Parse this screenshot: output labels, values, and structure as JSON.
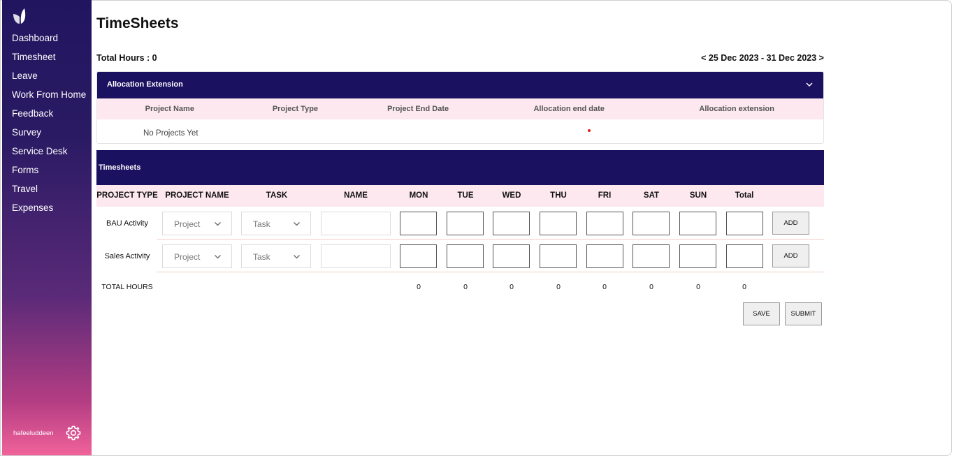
{
  "sidebar": {
    "items": [
      {
        "label": "Dashboard"
      },
      {
        "label": "Timesheet"
      },
      {
        "label": "Leave"
      },
      {
        "label": "Work From Home"
      },
      {
        "label": "Feedback"
      },
      {
        "label": "Survey"
      },
      {
        "label": "Service Desk"
      },
      {
        "label": "Forms"
      },
      {
        "label": "Travel"
      },
      {
        "label": "Expenses"
      }
    ],
    "username": "hafeeluddeen"
  },
  "page": {
    "title": "TimeSheets",
    "total_hours": "Total Hours : 0",
    "date_range": "< 25 Dec 2023 - 31 Dec 2023 >"
  },
  "allocation": {
    "title": "Allocation Extension",
    "columns": [
      "Project Name",
      "Project Type",
      "Project End Date",
      "Allocation end date",
      "Allocation extension"
    ],
    "empty_text": "No Projects Yet"
  },
  "timesheets": {
    "title": "Timesheets",
    "columns": [
      "PROJECT TYPE",
      "PROJECT NAME",
      "TASK",
      "NAME",
      "MON",
      "TUE",
      "WED",
      "THU",
      "FRI",
      "SAT",
      "SUN",
      "Total"
    ],
    "rows": [
      {
        "type": "BAU Activity",
        "project_placeholder": "Project",
        "task_placeholder": "Task",
        "add_label": "ADD"
      },
      {
        "type": "Sales Activity",
        "project_placeholder": "Project",
        "task_placeholder": "Task",
        "add_label": "ADD"
      }
    ],
    "totals": {
      "label": "TOTAL HOURS",
      "values": [
        "0",
        "0",
        "0",
        "0",
        "0",
        "0",
        "0",
        "0"
      ]
    },
    "save_label": "SAVE",
    "submit_label": "SUBMIT"
  },
  "colors": {
    "header_bg": "#1b1161",
    "column_header_bg": "#fde8f0",
    "sidebar_top": "#22155f",
    "sidebar_bottom": "#f0629a"
  }
}
